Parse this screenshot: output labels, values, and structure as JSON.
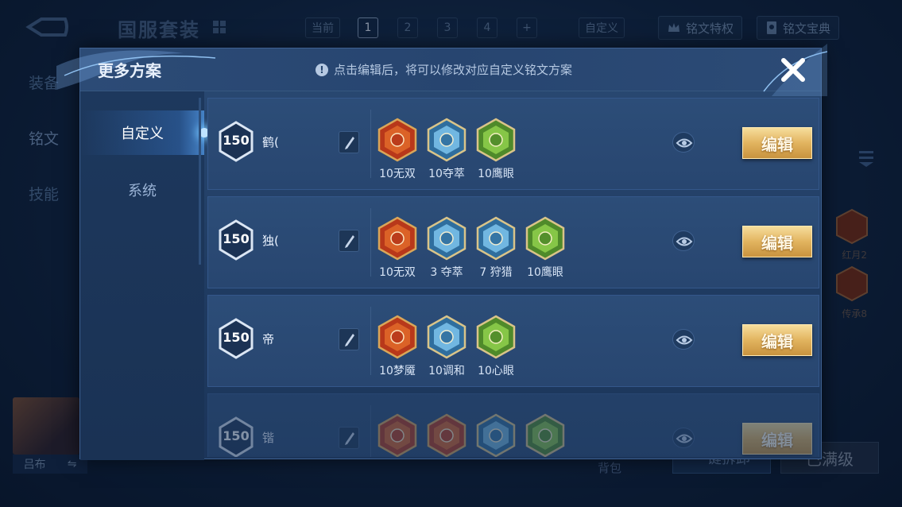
{
  "background": {
    "title": "国服套装",
    "topbar": {
      "current_label": "当前",
      "pages": [
        "1",
        "2",
        "3",
        "4",
        "+"
      ],
      "active_page": "1",
      "custom_label": "自定义",
      "privilege_label": "铭文特权",
      "guide_label": "铭文宝典"
    },
    "side_tabs": [
      "装备",
      "铭文",
      "技能"
    ],
    "right_runes": [
      "红月2",
      "传承8"
    ],
    "hero_name": "吕布",
    "swap_symbol": "⇋",
    "bag_label": "背包",
    "dismantle_label": "一键拆卸",
    "maxlevel_label": "已满级"
  },
  "modal": {
    "title": "更多方案",
    "hint": "点击编辑后，将可以修改对应自定义铭文方案",
    "hint_icon": "!",
    "close_icon": "close-icon",
    "nav": [
      {
        "label": "自定义",
        "active": true
      },
      {
        "label": "系统",
        "active": false
      }
    ],
    "edit_label": "编辑",
    "rows": [
      {
        "level": "150",
        "name": "鹤(",
        "runes": [
          {
            "label": "10无双",
            "color": "red"
          },
          {
            "label": "10夺萃",
            "color": "blue"
          },
          {
            "label": "10鹰眼",
            "color": "green"
          }
        ]
      },
      {
        "level": "150",
        "name": "独(",
        "runes": [
          {
            "label": "10无双",
            "color": "red"
          },
          {
            "label": "3 夺萃",
            "color": "blue"
          },
          {
            "label": "7 狩猎",
            "color": "blue"
          },
          {
            "label": "10鹰眼",
            "color": "green"
          }
        ]
      },
      {
        "level": "150",
        "name": "帝",
        "runes": [
          {
            "label": "10梦魇",
            "color": "red"
          },
          {
            "label": "10调和",
            "color": "blue"
          },
          {
            "label": "10心眼",
            "color": "green"
          }
        ]
      },
      {
        "level": "150",
        "name": "锴",
        "runes": [
          {
            "label": "",
            "color": "red"
          },
          {
            "label": "",
            "color": "red"
          },
          {
            "label": "",
            "color": "blue"
          },
          {
            "label": "",
            "color": "green"
          }
        ]
      }
    ]
  },
  "colors": {
    "gold_button": "#e2b45f",
    "rune_red": "#c8401e",
    "rune_blue": "#4fa2d6",
    "rune_green": "#6fae3a"
  }
}
